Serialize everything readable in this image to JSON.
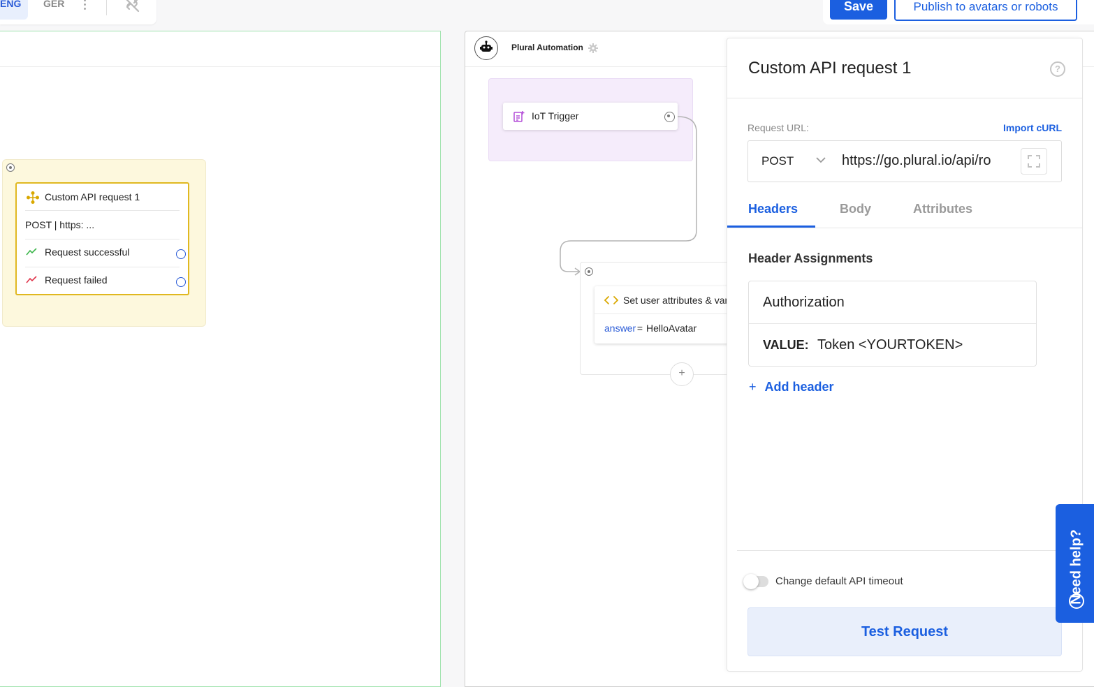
{
  "top_left": {
    "lang_eng": "ENG",
    "lang_ger": "GER",
    "icons": [
      "kebab-menu-icon",
      "link-off-icon"
    ]
  },
  "top_right": {
    "save_label": "Save",
    "publish_label": "Publish to avatars or robots"
  },
  "left_canvas": {
    "api_node": {
      "title": "Custom API request 1",
      "summary": "POST | https: ...",
      "outputs": [
        {
          "label": "Request successful",
          "icon": "trend-up-icon",
          "color": "#3bb54a"
        },
        {
          "label": "Request failed",
          "icon": "trend-down-icon",
          "color": "#e0344b"
        }
      ]
    }
  },
  "right_canvas": {
    "automation_title": "Plural Automation",
    "trigger": {
      "label": "IoT Trigger"
    },
    "set_node": {
      "title": "Set user attributes & vari",
      "assign_key": "answer",
      "assign_op": " = ",
      "assign_value": "HelloAvatar"
    }
  },
  "drawer": {
    "title": "Custom API request 1",
    "request_url_label": "Request URL:",
    "import_curl": "Import cURL",
    "method": "POST",
    "url": "https://go.plural.io/api/ro",
    "tabs": [
      {
        "label": "Headers",
        "active": true
      },
      {
        "label": "Body",
        "active": false
      },
      {
        "label": "Attributes",
        "active": false
      }
    ],
    "header_assignments_title": "Header Assignments",
    "header": {
      "key": "Authorization",
      "value_label": "VALUE:",
      "value": "Token <YOURTOKEN>"
    },
    "add_header": "Add header",
    "timeout_toggle_label": "Change default API timeout",
    "timeout_toggle_on": false,
    "test_button": "Test Request"
  },
  "help_tab": {
    "label": "Need help?"
  },
  "colors": {
    "accent": "#1b5fe0",
    "node_border": "#e0b820",
    "yellow_group": "#fdf8dd",
    "purple_group": "#f5ecfb"
  }
}
